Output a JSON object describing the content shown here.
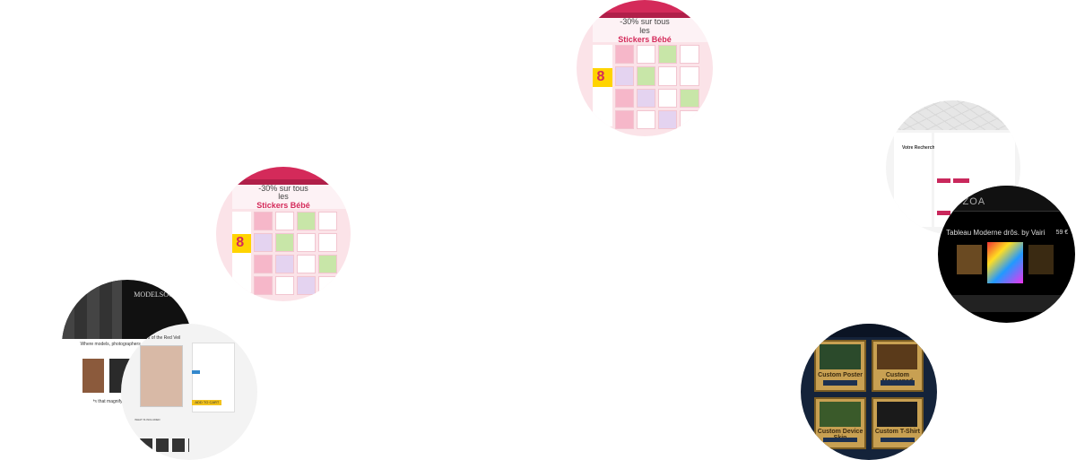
{
  "stickers": {
    "promo_line1": "-30% sur tous les",
    "promo_line2": "Stickers Bébé",
    "badge": "8"
  },
  "search": {
    "heading": "Votre Recherche"
  },
  "tableau": {
    "logo": "ZOA",
    "title": "Tableau Moderne drôs. by Vairi",
    "price": "59 €"
  },
  "models": {
    "logo": "MODELSOCIETY",
    "tagline": "Where models, photographers and artists con",
    "foot": "ts that magnify huma"
  },
  "veil": {
    "title": "...ers of the Red Veil",
    "add_button": "ADD TO CART",
    "foot": "WHAT IS INCLUDED"
  },
  "custom": {
    "cards": [
      {
        "label": "Custom Poster"
      },
      {
        "label": "Custom Mousepad"
      },
      {
        "label": "Custom Device Skin"
      },
      {
        "label": "Custom T-Shirt"
      }
    ]
  }
}
